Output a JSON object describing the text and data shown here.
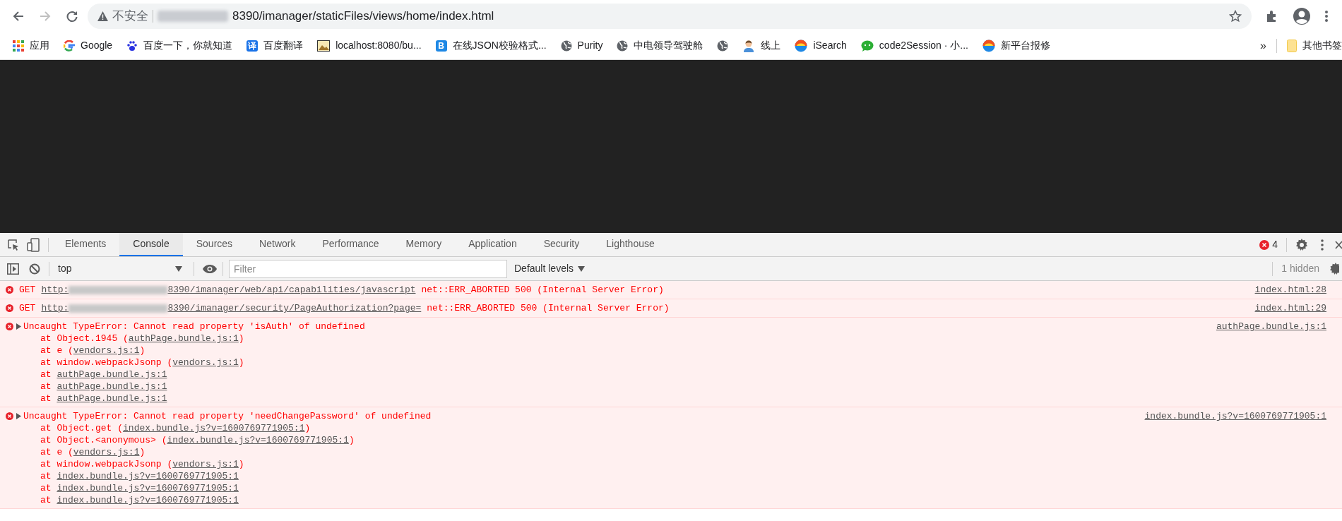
{
  "browser": {
    "back_disabled": false,
    "forward_disabled": true,
    "address": {
      "security_label": "不安全",
      "url": "8390/imanager/staticFiles/views/home/index.html"
    },
    "bookmarks": [
      {
        "kind": "apps",
        "label": "应用"
      },
      {
        "kind": "google",
        "label": "Google"
      },
      {
        "kind": "paw",
        "label": "百度一下，你就知道"
      },
      {
        "kind": "badge",
        "icon_text": "译",
        "color": "#1a73e8",
        "label": "百度翻译"
      },
      {
        "kind": "image",
        "label": "localhost:8080/bu..."
      },
      {
        "kind": "badge",
        "icon_text": "B",
        "color": "#1e88e5",
        "label": "在线JSON校验格式..."
      },
      {
        "kind": "globe",
        "label": "Purity"
      },
      {
        "kind": "globe",
        "label": "中电领导驾驶舱"
      },
      {
        "kind": "globe"
      },
      {
        "kind": "person",
        "label": "线上"
      },
      {
        "kind": "swirl",
        "label": "iSearch"
      },
      {
        "kind": "chat",
        "label": "code2Session · 小..."
      },
      {
        "kind": "swirl",
        "label": "新平台报修"
      }
    ],
    "overflow": "»",
    "other_bookmarks": "其他书签"
  },
  "devtools": {
    "tabs": [
      {
        "label": "Elements",
        "selected": false
      },
      {
        "label": "Console",
        "selected": true
      },
      {
        "label": "Sources",
        "selected": false
      },
      {
        "label": "Network",
        "selected": false
      },
      {
        "label": "Performance",
        "selected": false
      },
      {
        "label": "Memory",
        "selected": false
      },
      {
        "label": "Application",
        "selected": false
      },
      {
        "label": "Security",
        "selected": false
      },
      {
        "label": "Lighthouse",
        "selected": false
      }
    ],
    "error_count": "4",
    "toolbar": {
      "context": "top",
      "filter_placeholder": "Filter",
      "levels": "Default levels",
      "hidden": "1 hidden"
    },
    "messages": [
      {
        "kind": "network",
        "method": "GET",
        "url_prefix": "http:",
        "url": "8390/imanager/web/api/capabilities/javascript",
        "text": "net::ERR_ABORTED 500 (Internal Server Error)",
        "source": "index.html:28"
      },
      {
        "kind": "network",
        "method": "GET",
        "url_prefix": "http:",
        "url": "8390/imanager/security/PageAuthorization?page=",
        "text": "net::ERR_ABORTED 500 (Internal Server Error)",
        "source": "index.html:29"
      },
      {
        "kind": "exception",
        "expanded": false,
        "text": "Uncaught TypeError: Cannot read property 'isAuth' of undefined",
        "source": "authPage.bundle.js:1",
        "stack": [
          {
            "prefix": "at Object.1945 (",
            "link": "authPage.bundle.js:1",
            "suffix": ")"
          },
          {
            "prefix": "at e (",
            "link": "vendors.js:1",
            "suffix": ")"
          },
          {
            "prefix": "at window.webpackJsonp (",
            "link": "vendors.js:1",
            "suffix": ")"
          },
          {
            "prefix": "at ",
            "link": "authPage.bundle.js:1"
          },
          {
            "prefix": "at ",
            "link": "authPage.bundle.js:1"
          },
          {
            "prefix": "at ",
            "link": "authPage.bundle.js:1"
          }
        ]
      },
      {
        "kind": "exception",
        "expanded": false,
        "text": "Uncaught TypeError: Cannot read property 'needChangePassword' of undefined",
        "source": "index.bundle.js?v=1600769771905:1",
        "stack": [
          {
            "prefix": "at Object.get (",
            "link": "index.bundle.js?v=1600769771905:1",
            "suffix": ")"
          },
          {
            "prefix": "at Object.<anonymous> (",
            "link": "index.bundle.js?v=1600769771905:1",
            "suffix": ")"
          },
          {
            "prefix": "at e (",
            "link": "vendors.js:1",
            "suffix": ")"
          },
          {
            "prefix": "at window.webpackJsonp (",
            "link": "vendors.js:1",
            "suffix": ")"
          },
          {
            "prefix": "at ",
            "link": "index.bundle.js?v=1600769771905:1"
          },
          {
            "prefix": "at ",
            "link": "index.bundle.js?v=1600769771905:1"
          },
          {
            "prefix": "at ",
            "link": "index.bundle.js?v=1600769771905:1"
          }
        ]
      }
    ]
  }
}
